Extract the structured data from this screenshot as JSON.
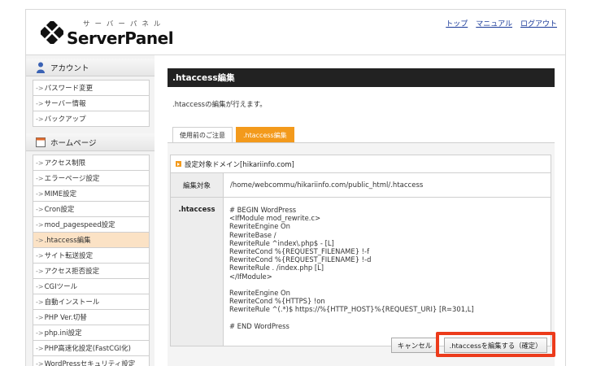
{
  "header": {
    "logo_kana": "サーバーパネル",
    "logo_text": "ServerPanel",
    "links": [
      "トップ",
      "マニュアル",
      "ログアウト"
    ]
  },
  "sidebar": {
    "account": {
      "title": "アカウント",
      "items": [
        "パスワード変更",
        "サーバー情報",
        "バックアップ"
      ]
    },
    "homepage": {
      "title": "ホームページ",
      "items": [
        "アクセス制限",
        "エラーページ設定",
        "MIME設定",
        "Cron設定",
        "mod_pagespeed設定",
        ".htaccess編集",
        "サイト転送設定",
        "アクセス拒否設定",
        "CGIツール",
        "自動インストール",
        "PHP Ver.切替",
        "php.ini設定",
        "PHP高速化設定(FastCGI化)",
        "WordPressセキュリティ設定"
      ],
      "active_index": 5
    }
  },
  "main": {
    "title": ".htaccess編集",
    "description": ".htaccessの編集が行えます。",
    "tabs": [
      "使用前のご注意",
      ".htaccess編集"
    ],
    "active_tab": 1,
    "domain_label": "設定対象ドメイン[hikariinfo.com]",
    "target_label": "編集対象",
    "target_value": "/home/webcommu/hikariinfo.com/public_html/.htaccess",
    "htaccess_label": ".htaccess",
    "htaccess_content": "# BEGIN WordPress\n<IfModule mod_rewrite.c>\nRewriteEngine On\nRewriteBase /\nRewriteRule ^index\\.php$ - [L]\nRewriteCond %{REQUEST_FILENAME} !-f\nRewriteCond %{REQUEST_FILENAME} !-d\nRewriteRule . /index.php [L]\n</IfModule>\n\nRewriteEngine On\nRewriteCond %{HTTPS} !on\nRewriteRule ^(.*)$ https://%{HTTP_HOST}%{REQUEST_URI} [R=301,L]\n\n# END WordPress",
    "cancel_label": "キャンセル",
    "confirm_label": ".htaccessを編集する（確定）"
  },
  "colors": {
    "accent": "#f39a1c",
    "title_bar": "#222222",
    "active_menu": "#fbe2c5",
    "highlight": "#ec3b1b"
  },
  "icons": [
    "serverpanel-logo-icon",
    "account-user-icon",
    "homepage-icon",
    "arrow-icon",
    "domain-marker-icon"
  ]
}
